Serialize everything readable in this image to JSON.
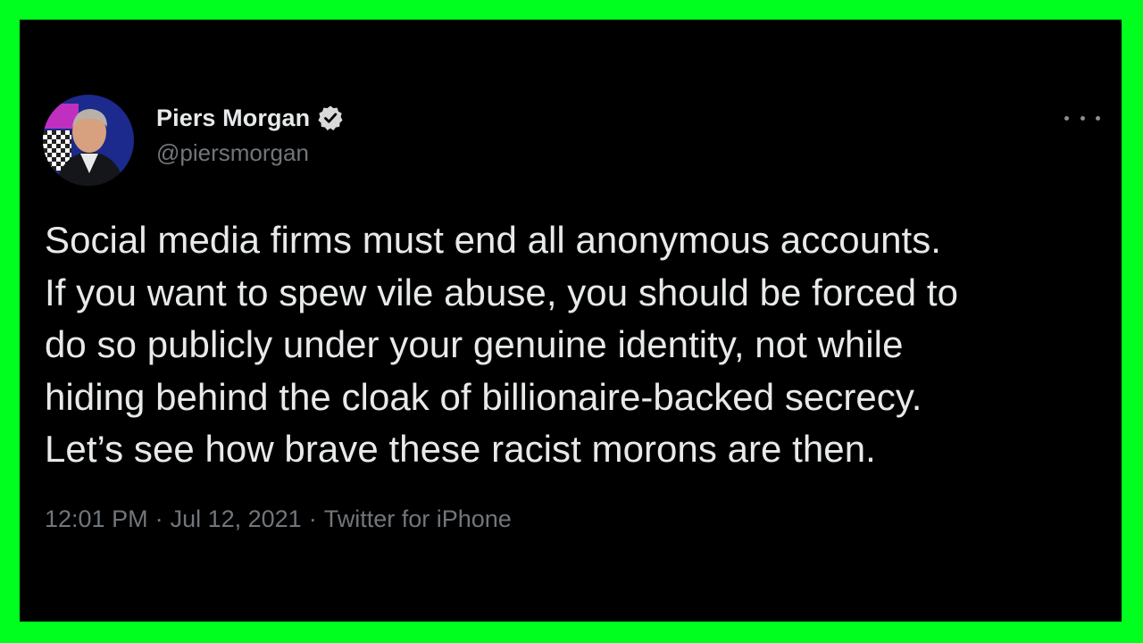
{
  "tweet": {
    "author": {
      "display_name": "Piers Morgan",
      "handle": "@piersmorgan",
      "verified": true
    },
    "text": "Social media firms must end all anonymous accounts.\nIf you want to spew vile abuse, you should be forced to\ndo so publicly under your genuine identity, not while\nhiding behind the cloak of billionaire-backed secrecy.\nLet’s see how brave these racist morons are then.",
    "time": "12:01 PM",
    "date": "Jul 12, 2021",
    "source": "Twitter for iPhone",
    "separator": "·"
  },
  "icons": {
    "verified": "verified-badge-icon",
    "more": "more-options-icon"
  },
  "colors": {
    "frame": "#00ff1e",
    "background": "#000000",
    "text_primary": "#e7e9ea",
    "text_secondary": "#71767b"
  }
}
